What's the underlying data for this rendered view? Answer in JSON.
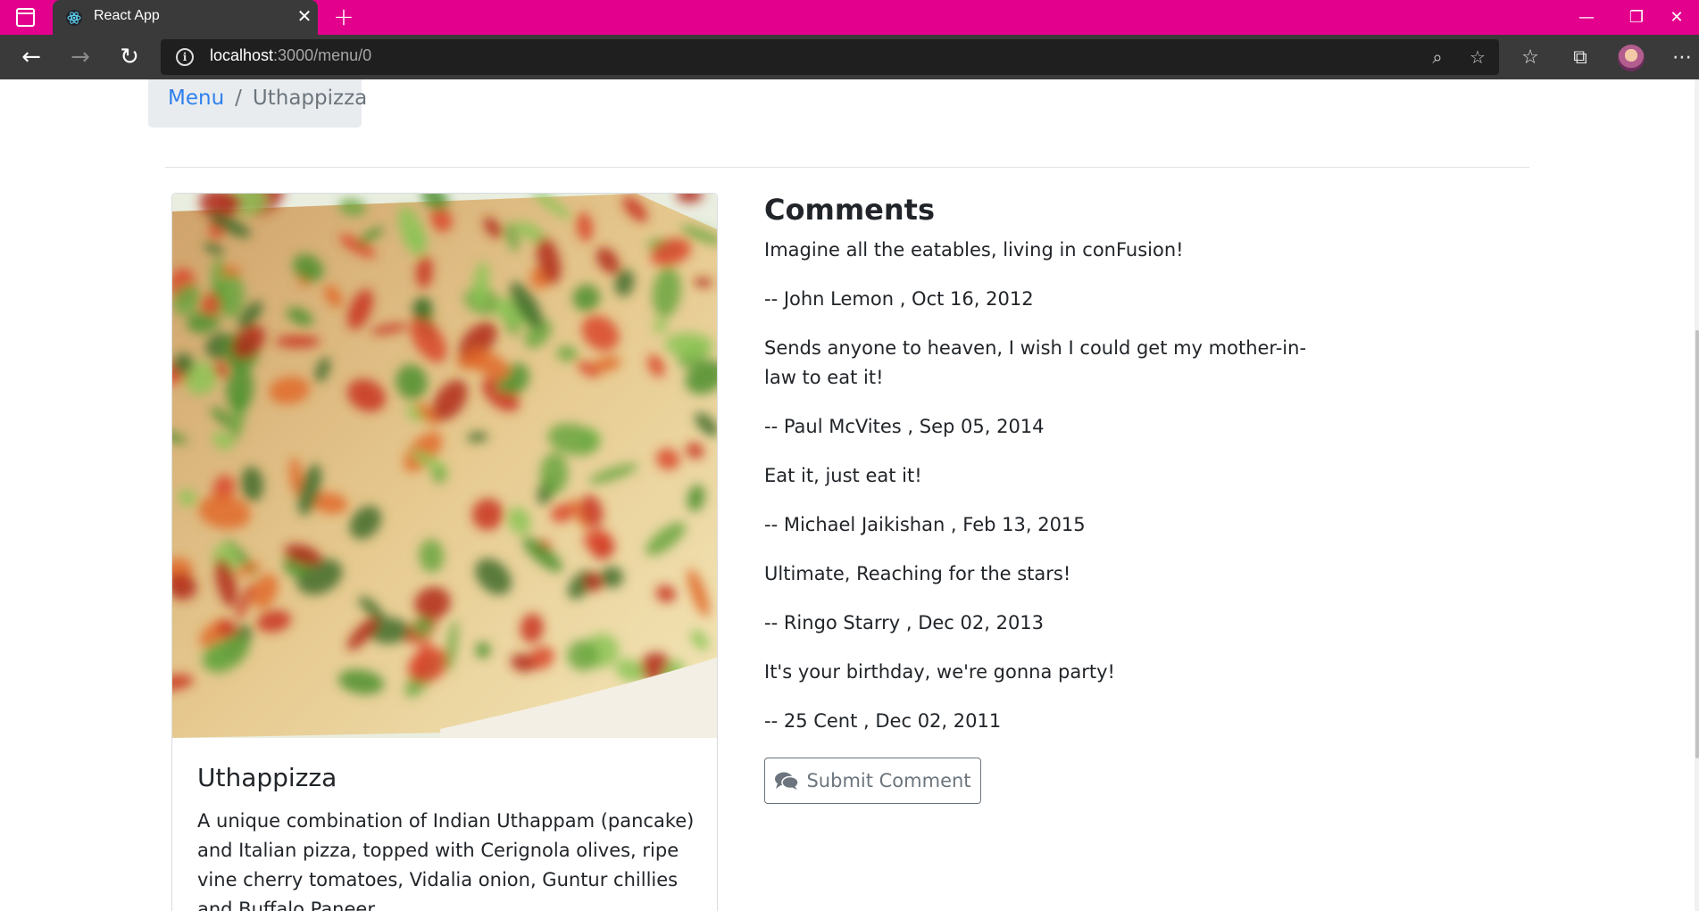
{
  "browser": {
    "tab_title": "React App",
    "url_host": "localhost",
    "url_rest": ":3000/menu/0",
    "accent_color": "#e3008c",
    "icons": [
      "sidebar-icon",
      "react-logo-icon",
      "close-icon",
      "plus-icon",
      "back-icon",
      "forward-icon",
      "refresh-icon",
      "info-icon",
      "zoom-icon",
      "add-favorite-icon",
      "favorites-icon",
      "collections-icon",
      "profile-avatar",
      "more-icon",
      "minimize-icon",
      "restore-icon",
      "window-close-icon"
    ]
  },
  "breadcrumb": {
    "link": "Menu",
    "separator": "/",
    "active": "Uthappizza"
  },
  "dish": {
    "name": "Uthappizza",
    "description": "A unique combination of Indian Uthappam (pancake) and Italian pizza, topped with Cerignola olives, ripe vine cherry tomatoes, Vidalia onion, Guntur chillies and Buffalo Paneer.",
    "image_alt": "Uthappizza"
  },
  "comments": {
    "heading": "Comments",
    "items": [
      {
        "text": "Imagine all the eatables, living in conFusion!",
        "meta": "-- John Lemon , Oct 16, 2012"
      },
      {
        "text": "Sends anyone to heaven, I wish I could get my mother-in-law to eat it!",
        "meta": "-- Paul McVites , Sep 05, 2014"
      },
      {
        "text": "Eat it, just eat it!",
        "meta": "-- Michael Jaikishan , Feb 13, 2015"
      },
      {
        "text": "Ultimate, Reaching for the stars!",
        "meta": "-- Ringo Starry , Dec 02, 2013"
      },
      {
        "text": "It's your birthday, we're gonna party!",
        "meta": "-- 25 Cent , Dec 02, 2011"
      }
    ],
    "submit_label": "Submit Comment"
  }
}
